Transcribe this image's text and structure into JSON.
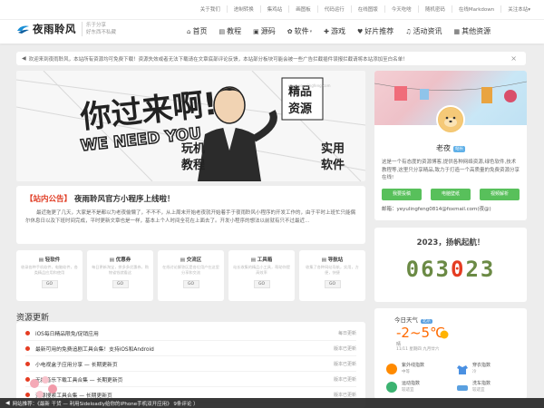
{
  "top_links": [
    "关于我们",
    "进制转换",
    "集鸡站",
    "画图板",
    "代码运行",
    "在线图版",
    "今天吃啥",
    "随机密码",
    "在线Markdown",
    "关注本站▾"
  ],
  "logo": {
    "name": "夜雨聆风",
    "slogan_1": "乐于分享",
    "slogan_2": "好东西不私藏"
  },
  "nav": [
    {
      "icon": "home-icon",
      "glyph": "⌂",
      "label": "首页",
      "dropdown": false
    },
    {
      "icon": "book-icon",
      "glyph": "▤",
      "label": "教程",
      "dropdown": false
    },
    {
      "icon": "code-icon",
      "glyph": "▣",
      "label": "源码",
      "dropdown": false
    },
    {
      "icon": "gear-icon",
      "glyph": "✿",
      "label": "软件",
      "dropdown": true
    },
    {
      "icon": "gamepad-icon",
      "glyph": "✚",
      "label": "游戏",
      "dropdown": false
    },
    {
      "icon": "heart-icon",
      "glyph": "♥",
      "label": "好片推荐",
      "dropdown": false
    },
    {
      "icon": "chat-icon",
      "glyph": "♫",
      "label": "活动资讯",
      "dropdown": false
    },
    {
      "icon": "grid-icon",
      "glyph": "▦",
      "label": "其他资源",
      "dropdown": false
    }
  ],
  "notice": "欢迎来到夜雨聆风，本站所有资源均可免费下载！资源失效或者无法下载请在文章底部评论反馈，本站部分板块可能会被一些广告拦截插件误报拦截请将本站添加至白名单！",
  "banner": {
    "line1": "你过来啊!",
    "line2": "WE NEED YOU",
    "left1": "玩机",
    "left2": "教程",
    "right1": "精品",
    "right2": "资源",
    "right3": "实用",
    "right4": "软件",
    "watermark": "www.yeyulingfeng.com"
  },
  "announcement": {
    "tag": "【站内公告】",
    "title": "夜雨聆风官方小程序上线啦！",
    "body": "最近拖更了几天，大家是不是都以为老夜偷懒了，不不不，从上周末开始老夜就开始着手于夜雨聆风小程序的开发工作的，由于平时上班忙只能偶尔休息日以及下班时间完成，平时更新文章也是一样，基本上个人时间全花在上面去了。开发小程序的想法以前就有只不过最近..."
  },
  "categories": [
    {
      "title": "▤ 轻软件",
      "desc": "收录各种手机软件，电脑软件，各类精品应用和使用"
    },
    {
      "title": "▤ 优惠券",
      "desc": "每日更新淘宝，拼多多优惠券，购物省钱就看这"
    },
    {
      "title": "▤ 交流区",
      "desc": "在线讨论解答区是各位用户在这里分享和交流"
    },
    {
      "title": "▤ 工具箱",
      "desc": "站长收集的精品小工具，帮助你提高效率"
    },
    {
      "title": "▤ 导航站",
      "desc": "收集了各种网站导航，实用，方便，快捷"
    }
  ],
  "category_button": "GO",
  "resources": {
    "heading": "资源更新",
    "items": [
      {
        "title": "iOS每日精品限免/促销应用",
        "category": "每日更新"
      },
      {
        "title": "最新可用的免费追剧工具合集！支持iOS和Android",
        "category": "版本已更新"
      },
      {
        "title": "小电视盒子应用分享 — 长期更新页",
        "category": "版本已更新"
      },
      {
        "title": "无损音乐下载工具合集 — 长期更新页",
        "category": "版本已更新"
      },
      {
        "title": "资源搜索工具合集 — 长期更新页",
        "category": "版本已更新"
      }
    ]
  },
  "profile": {
    "name": "老夜",
    "badge": "站长",
    "desc": "这是一个有态度的资源博客,提供各种网络资源,绿色软件,技术教程等,这里只分享精品,致力于打造一个高质量的免费资源分享在线!",
    "buttons": [
      "我要投稿",
      "电脑壁纸",
      "视频解析"
    ],
    "email": "邮箱：yeyulingfeng0814@foxmail.com(夜@)"
  },
  "counter": {
    "title": "2023，扬帆起航！",
    "digits_a": "063",
    "digits_b": "0",
    "digits_c": "23"
  },
  "weather": {
    "heading": "今日天气",
    "location": "北京",
    "temp": "-2~5℃",
    "condition": "晴",
    "date": "11/11 星期四 九月廿六",
    "indices": [
      {
        "label": "紫外线指数",
        "value": "中等"
      },
      {
        "label": "穿衣指数",
        "value": "冷"
      },
      {
        "label": "运动指数",
        "value": "较适宜"
      },
      {
        "label": "洗车指数",
        "value": "较适宜"
      }
    ]
  },
  "footer": "网站推荐：《最新 干货 — 利用Sideloadly给你的iPhone手机双开应用》 9条评论 ）"
}
